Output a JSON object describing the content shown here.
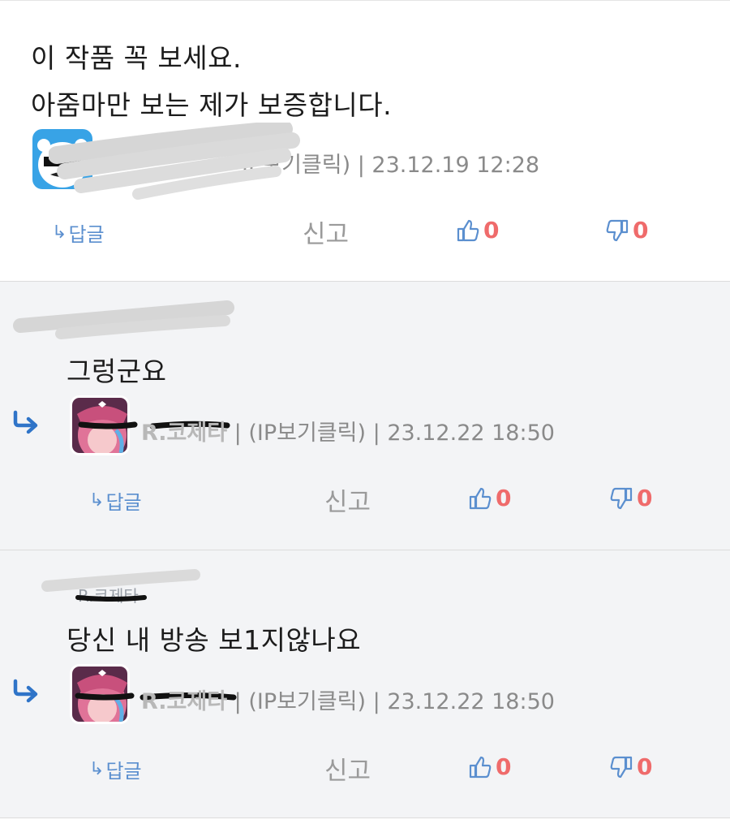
{
  "comments": [
    {
      "lines": [
        "이 작품 꼭 보세요.",
        "아줌마만 보는 제가 보증합니다."
      ],
      "meta_ip": "IP보기클릭)",
      "timestamp": "23.12.19 12:28",
      "reply_label": "답글",
      "report_label": "신고",
      "upvotes": "0",
      "downvotes": "0"
    },
    {
      "quoted_partial": "",
      "lines": [
        "그렁군요"
      ],
      "nickname": "R.코제타",
      "meta_ip": "(IP보기클릭)",
      "timestamp": "23.12.22 18:50",
      "reply_label": "답글",
      "report_label": "신고",
      "upvotes": "0",
      "downvotes": "0"
    },
    {
      "quoted_partial": "R.코제타",
      "lines": [
        "당신 내 방송 보1지않나요"
      ],
      "nickname": "R.코제타",
      "meta_ip": "(IP보기클릭)",
      "timestamp": "23.12.22 18:50",
      "reply_label": "답글",
      "report_label": "신고",
      "upvotes": "0",
      "downvotes": "0"
    }
  ],
  "colors": {
    "accent_blue": "#5b8fcf",
    "vote_red": "#ef6b6b",
    "muted": "#8a8a8a",
    "reply_bg": "#f3f4f6"
  },
  "icons": {
    "reply": "reply-arrow-icon",
    "up": "thumbs-up-icon",
    "down": "thumbs-down-icon"
  }
}
